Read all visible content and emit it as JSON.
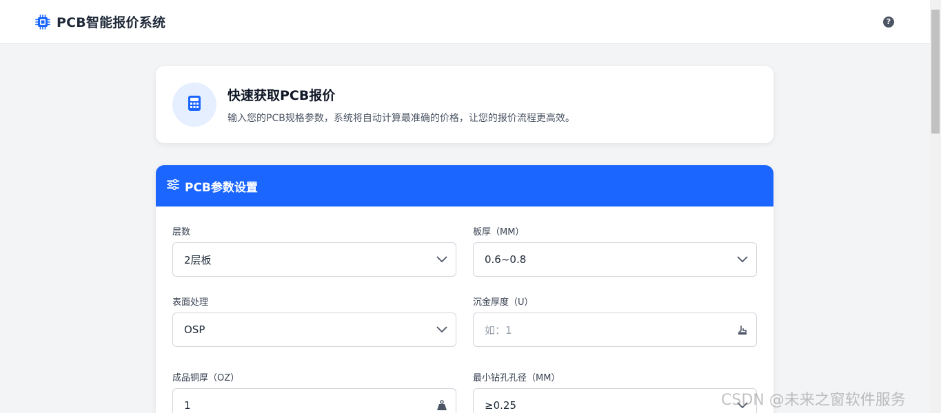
{
  "header": {
    "title": "PCB智能报价系统",
    "brand_icon": "chip-icon",
    "help_icon": "question-circle-icon",
    "help_glyph": "?"
  },
  "intro": {
    "icon": "calculator-icon",
    "title": "快速获取PCB报价",
    "description": "输入您的PCB规格参数，系统将自动计算最准确的价格，让您的报价流程更高效。"
  },
  "params": {
    "header_icon": "sliders-icon",
    "title": "PCB参数设置",
    "fields": {
      "layers": {
        "label": "层数",
        "value": "2层板",
        "type": "select"
      },
      "thickness": {
        "label": "板厚（MM）",
        "value": "0.6~0.8",
        "type": "select"
      },
      "surface": {
        "label": "表面处理",
        "value": "OSP",
        "type": "select"
      },
      "gold": {
        "label": "沉金厚度（U）",
        "placeholder": "如：1",
        "type": "input",
        "icon": "weight-scale-icon"
      },
      "copper": {
        "label": "成品铜厚（OZ）",
        "value": "1",
        "type": "input",
        "icon": "weight-icon"
      },
      "drill": {
        "label": "最小钻孔孔径（MM）",
        "value": "≥0.25",
        "type": "select"
      }
    }
  },
  "watermark": "CSDN @未来之窗软件服务",
  "colors": {
    "accent": "#1a66ff",
    "page_bg": "#f3f4f6",
    "icon_bg": "#e6efff"
  }
}
